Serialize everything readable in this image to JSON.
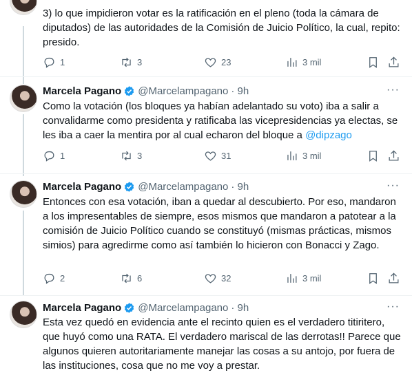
{
  "tweets": [
    {
      "text": "3) lo que impidieron votar es la ratificación en el pleno (toda la cámara de diputados) de las autoridades de la Comisión de Juicio Político, la cual, repito: presido.",
      "replies": "1",
      "retweets": "3",
      "likes": "23",
      "views": "3 mil"
    },
    {
      "name": "Marcela Pagano",
      "handle": "@Marcelampagano",
      "time": "· 9h",
      "text": "Como la votación (los bloques ya habían adelantado su voto) iba a salir a convalidarme como presidenta y ratificaba las vicepresidencias ya electas, se les iba a caer la mentira por al cual echaron del bloque a ",
      "mention": "@dipzago",
      "replies": "1",
      "retweets": "3",
      "likes": "31",
      "views": "3 mil"
    },
    {
      "name": "Marcela Pagano",
      "handle": "@Marcelampagano",
      "time": "· 9h",
      "text": "Entonces con esa votación, iban a quedar al descubierto. Por eso, mandaron a los impresentables de siempre, esos mismos que mandaron a patotear a la comisión de Juicio Político cuando se constituyó (mismas prácticas, mismos simios) para agredirme como así también lo hicieron con Bonacci y Zago.",
      "replies": "2",
      "retweets": "6",
      "likes": "32",
      "views": "3 mil"
    },
    {
      "name": "Marcela Pagano",
      "handle": "@Marcelampagano",
      "time": "· 9h",
      "text": "Esta vez quedó en evidencia ante el recinto quien es el verdadero titiritero, que huyó como una RATA. El verdadero mariscal de las derrotas!! Parece que algunos quieren autoritariamente manejar las cosas a su antojo, por fuera de las instituciones, cosa que no me voy a prestar."
    }
  ],
  "more_label": "···",
  "colors": {
    "verified": "#1d9bf0",
    "link": "#1d9bf0",
    "muted": "#536471"
  },
  "icons": [
    "reply-icon",
    "retweet-icon",
    "like-icon",
    "views-icon",
    "bookmark-icon",
    "share-icon",
    "verified-icon",
    "more-icon"
  ]
}
